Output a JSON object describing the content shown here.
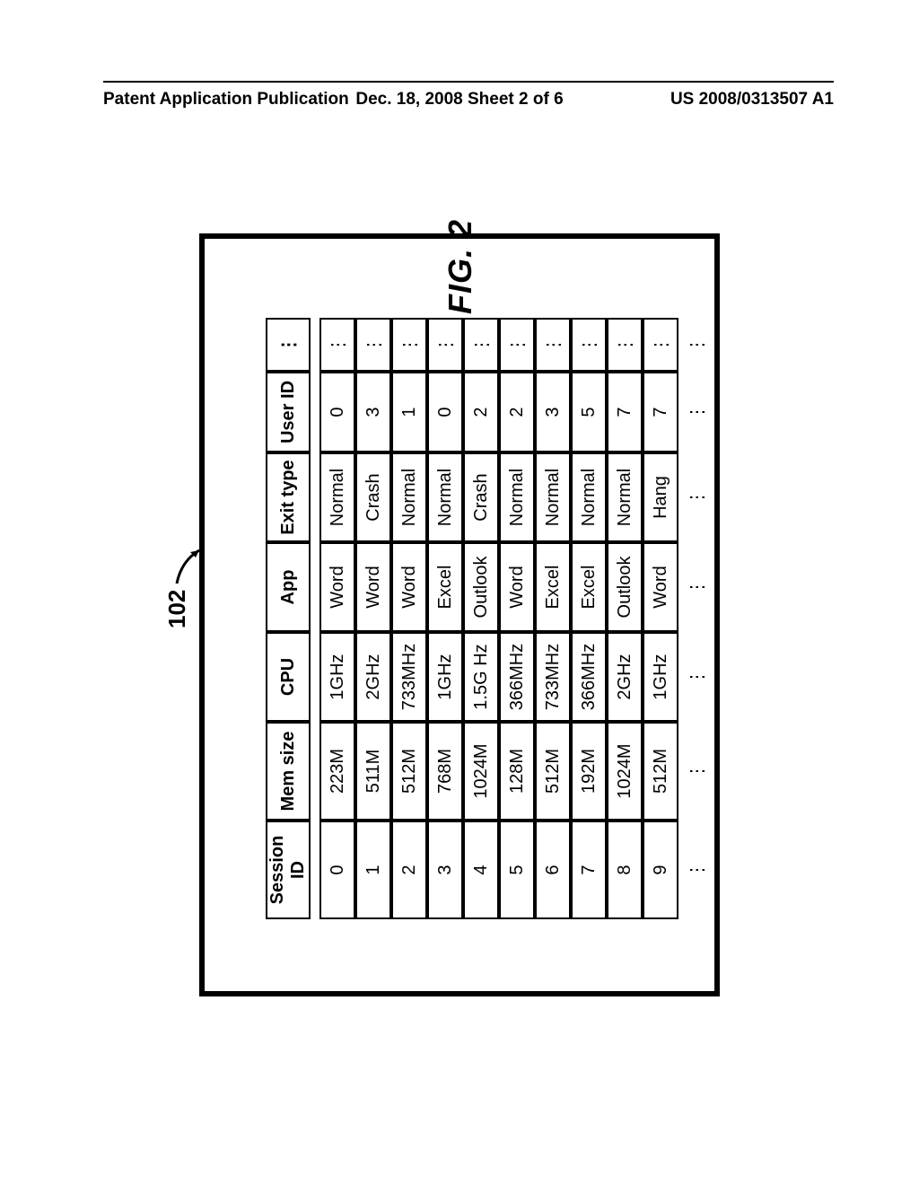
{
  "header": {
    "left": "Patent Application Publication",
    "mid": "Dec. 18, 2008  Sheet 2 of 6",
    "right": "US 2008/0313507 A1"
  },
  "ref_number": "102",
  "figure_caption": "FIG. 2",
  "table": {
    "columns": [
      "Session ID",
      "Mem size",
      "CPU",
      "App",
      "Exit type",
      "User ID",
      "⋮"
    ],
    "rows": [
      [
        "0",
        "223M",
        "1GHz",
        "Word",
        "Normal",
        "0",
        "⋮"
      ],
      [
        "1",
        "511M",
        "2GHz",
        "Word",
        "Crash",
        "3",
        "⋮"
      ],
      [
        "2",
        "512M",
        "733MHz",
        "Word",
        "Normal",
        "1",
        "⋮"
      ],
      [
        "3",
        "768M",
        "1GHz",
        "Excel",
        "Normal",
        "0",
        "⋮"
      ],
      [
        "4",
        "1024M",
        "1.5G Hz",
        "Outlook",
        "Crash",
        "2",
        "⋮"
      ],
      [
        "5",
        "128M",
        "366MHz",
        "Word",
        "Normal",
        "2",
        "⋮"
      ],
      [
        "6",
        "512M",
        "733MHz",
        "Excel",
        "Normal",
        "3",
        "⋮"
      ],
      [
        "7",
        "192M",
        "366MHz",
        "Excel",
        "Normal",
        "5",
        "⋮"
      ],
      [
        "8",
        "1024M",
        "2GHz",
        "Outlook",
        "Normal",
        "7",
        "⋮"
      ],
      [
        "9",
        "512M",
        "1GHz",
        "Word",
        "Hang",
        "7",
        "⋮"
      ],
      [
        "⋮",
        "⋮",
        "⋮",
        "⋮",
        "⋮",
        "⋮",
        "⋮"
      ]
    ]
  }
}
